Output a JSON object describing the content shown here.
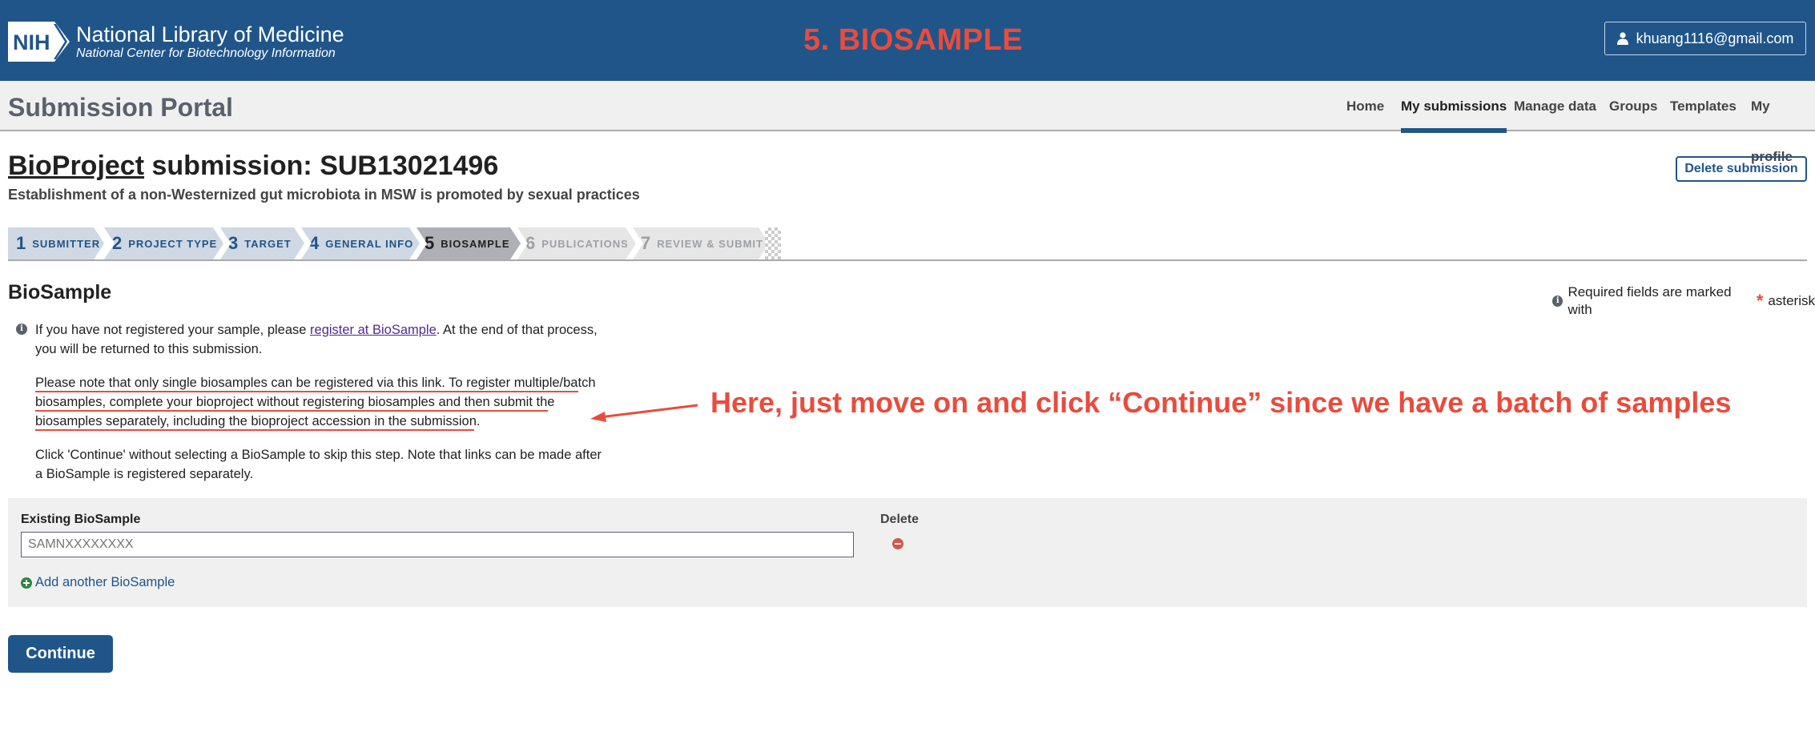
{
  "header": {
    "logo_text": "NIH",
    "org_title": "National Library of Medicine",
    "org_subtitle": "National Center for Biotechnology Information",
    "banner": "5. BIOSAMPLE",
    "user_email": "khuang1116@gmail.com"
  },
  "portal": {
    "title": "Submission Portal",
    "nav": [
      "Home",
      "My submissions",
      "Manage data",
      "Groups",
      "Templates",
      "My profile"
    ],
    "active_nav": "My submissions"
  },
  "submission": {
    "title_link": "BioProject",
    "title_rest": " submission: SUB13021496",
    "description": "Establishment of a non-Westernized gut microbiota in MSW is promoted by sexual practices",
    "delete_label": "Delete submission"
  },
  "steps": [
    {
      "num": "1",
      "label": "SUBMITTER",
      "state": "done"
    },
    {
      "num": "2",
      "label": "PROJECT TYPE",
      "state": "done"
    },
    {
      "num": "3",
      "label": "TARGET",
      "state": "done"
    },
    {
      "num": "4",
      "label": "GENERAL INFO",
      "state": "done"
    },
    {
      "num": "5",
      "label": "BIOSAMPLE",
      "state": "active"
    },
    {
      "num": "6",
      "label": "PUBLICATIONS",
      "state": "future"
    },
    {
      "num": "7",
      "label": "REVIEW & SUBMIT",
      "state": "future"
    }
  ],
  "biosample": {
    "section_title": "BioSample",
    "required_note": "Required fields are marked with",
    "required_word": "asterisk",
    "info_p1_before": "If you have not registered your sample, please ",
    "info_p1_link": "register at BioSample",
    "info_p1_after": ". At the end of that process, you will be returned to this submission.",
    "info_p2": "Please note that only single biosamples can be registered via this link. To register multiple/batch biosamples, complete your bioproject without registering biosamples and then submit the biosamples separately, including the bioproject accession in the submission.",
    "info_p3": "Click 'Continue' without selecting a BioSample to skip this step. Note that links can be made after a BioSample is registered separately.",
    "existing_label": "Existing BioSample",
    "delete_label": "Delete",
    "input_placeholder": "SAMNXXXXXXXX",
    "add_label": "Add another BioSample",
    "continue_label": "Continue"
  },
  "annotation": "Here, just move on and click “Continue” since we have a batch of samples",
  "colors": {
    "header_bg": "#20558a",
    "annotation": "#e84c3d",
    "panel_bg": "#f0f0f0"
  }
}
